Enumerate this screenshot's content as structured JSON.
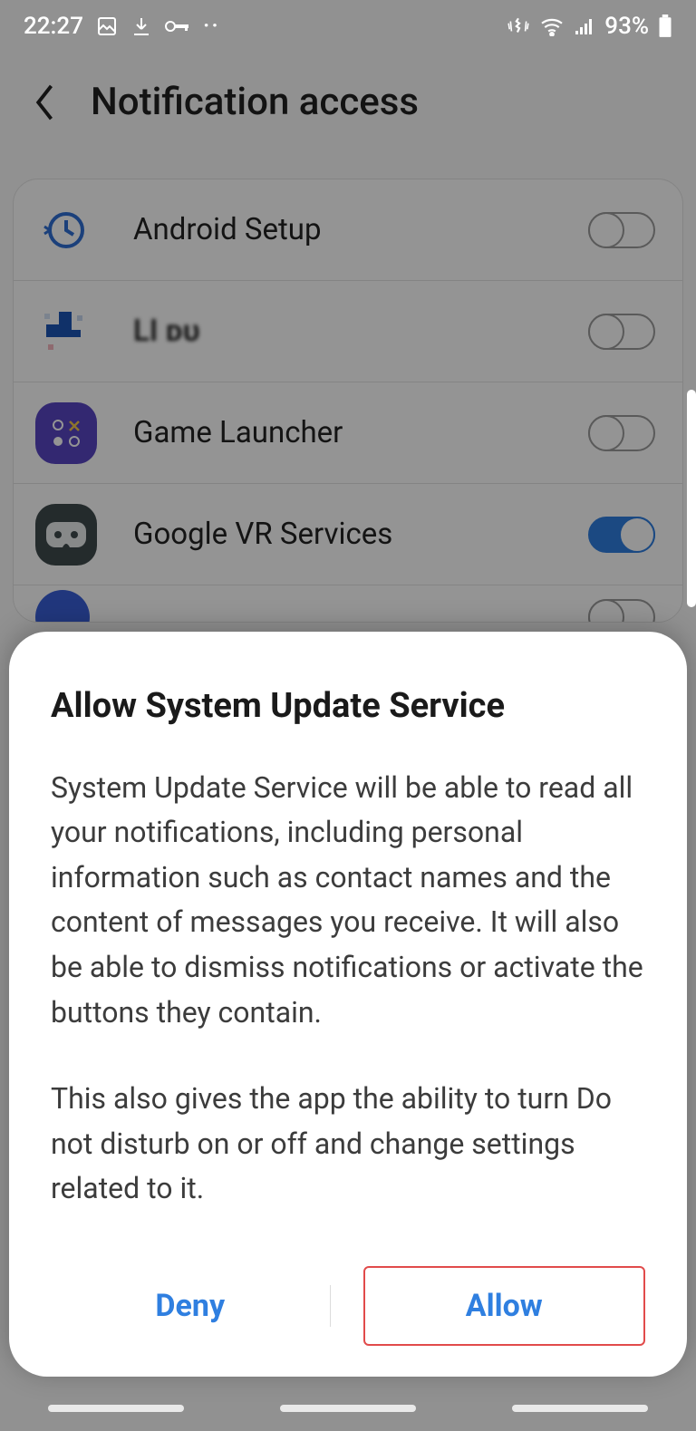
{
  "status": {
    "time": "22:27",
    "battery_pct": "93%"
  },
  "header": {
    "title": "Notification access"
  },
  "apps": [
    {
      "label": "Android Setup",
      "on": false
    },
    {
      "label": "LI ᴅᴜ",
      "on": false
    },
    {
      "label": "Game Launcher",
      "on": false
    },
    {
      "label": "Google VR Services",
      "on": true
    }
  ],
  "dialog": {
    "title": "Allow System Update Service",
    "para1": "System Update Service will be able to read all your notifications, including personal information such as contact names and the content of messages you receive. It will also be able to dismiss notifications or activate the buttons they contain.",
    "para2": "This also gives the app the ability to turn Do not disturb on or off and change settings related to it.",
    "deny": "Deny",
    "allow": "Allow"
  }
}
